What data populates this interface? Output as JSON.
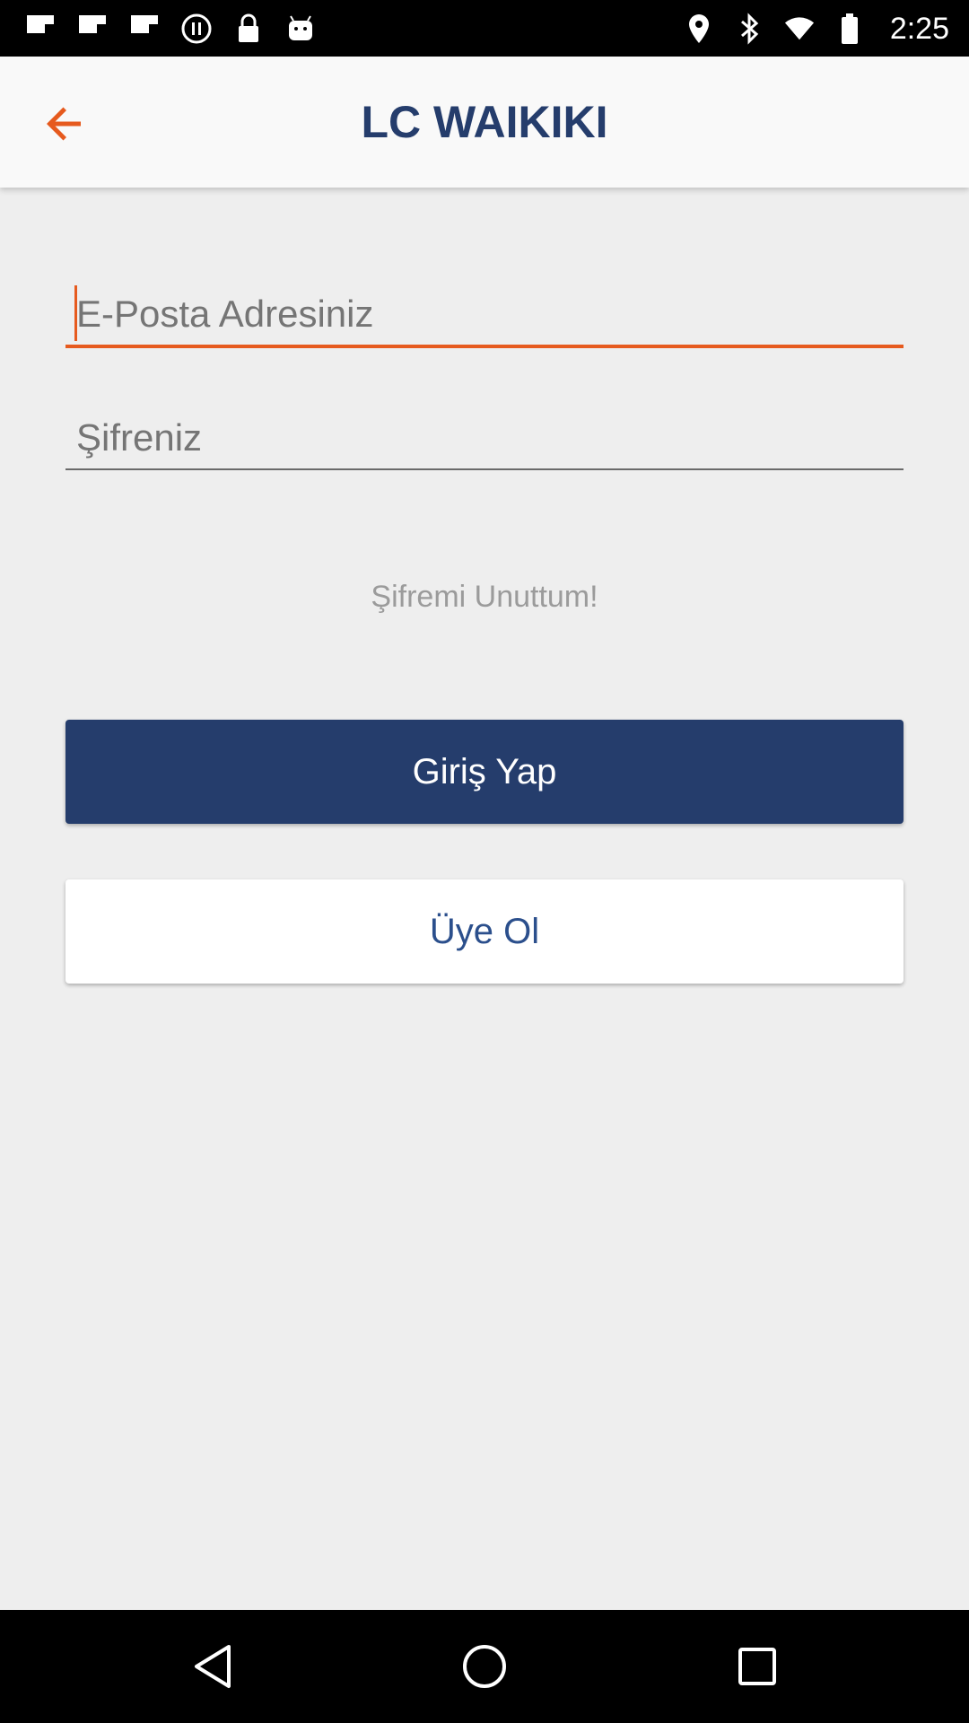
{
  "status_bar": {
    "time": "2:25",
    "left_icons": [
      "flipboard-icon",
      "flipboard-icon",
      "flipboard-icon",
      "pause-circle-icon",
      "lock-icon",
      "android-icon"
    ],
    "right_icons": [
      "location-icon",
      "bluetooth-icon",
      "wifi-icon",
      "battery-icon"
    ]
  },
  "toolbar": {
    "logo_text": "LC WAIKIKI",
    "accent_color": "#e65a1e"
  },
  "form": {
    "email_placeholder": "E-Posta Adresiniz",
    "password_placeholder": "Şifreniz",
    "forgot_password": "Şifremi Unuttum!",
    "login_button": "Giriş Yap",
    "register_button": "Üye Ol"
  },
  "colors": {
    "primary": "#253d6c",
    "accent": "#e65a1e",
    "background": "#eeeeee"
  },
  "nav_bar": {
    "icons": [
      "back-triangle-icon",
      "home-circle-icon",
      "recents-square-icon"
    ]
  }
}
